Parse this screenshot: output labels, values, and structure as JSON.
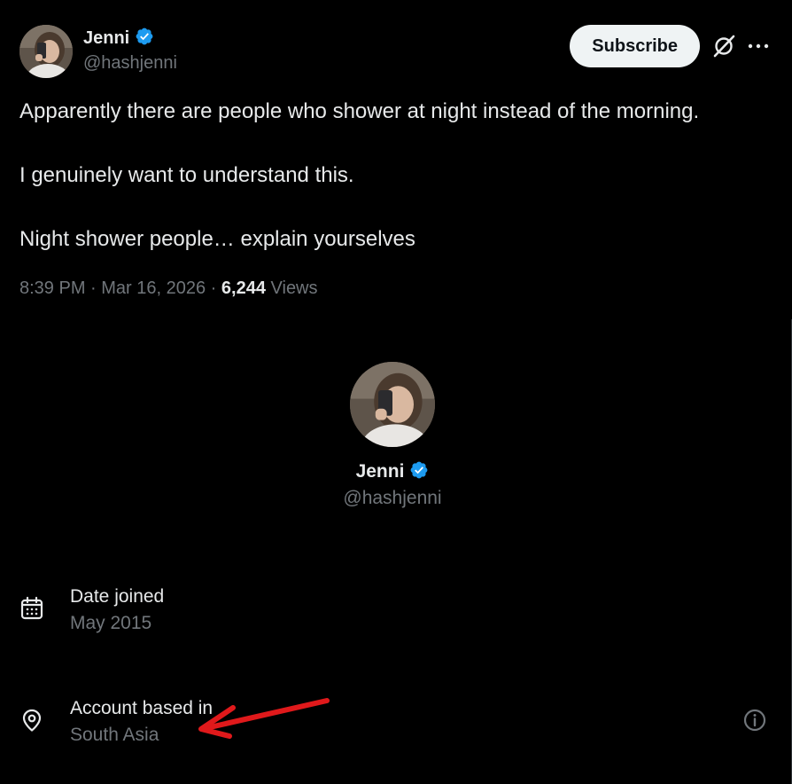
{
  "post": {
    "author": {
      "name": "Jenni",
      "handle": "@hashjenni",
      "verified_color": "#1d9bf0"
    },
    "subscribe_label": "Subscribe",
    "text_lines": [
      "Apparently there are people who shower at night instead of the morning.",
      "I genuinely want to understand this.",
      "Night shower people… explain yourselves"
    ],
    "timestamp": "8:39 PM · Mar 16, 2026",
    "meta_sep": " · ",
    "views_count": "6,244",
    "views_label": "Views"
  },
  "profile_card": {
    "name": "Jenni",
    "handle": "@hashjenni"
  },
  "about": {
    "date_joined_label": "Date joined",
    "date_joined_value": "May 2015",
    "location_label": "Account based in",
    "location_value": "South Asia"
  },
  "icons": {
    "verified": "verified-badge-icon",
    "grok": "grok-icon",
    "more": "more-icon",
    "calendar": "calendar-icon",
    "location": "location-pin-icon",
    "info": "info-icon"
  },
  "annotation": {
    "arrow_color": "#e0191b"
  }
}
